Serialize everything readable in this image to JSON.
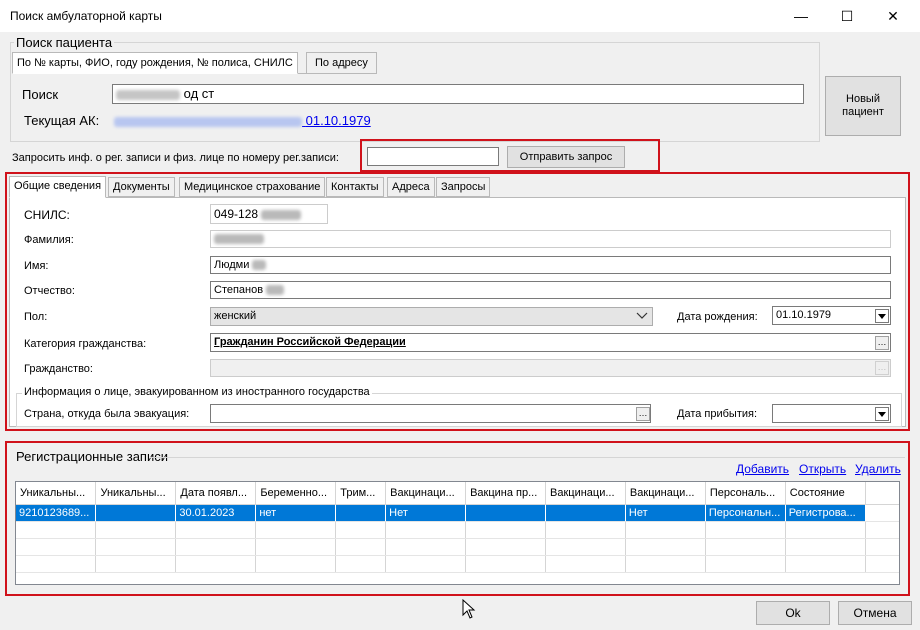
{
  "window": {
    "title": "Поиск амбулаторной карты",
    "minimize": "—",
    "maximize": "☐",
    "close": "✕"
  },
  "patient_search": {
    "group_title": "Поиск пациента",
    "tabs": [
      {
        "label": "По № карты, ФИО, году рождения, № полиса, СНИЛС"
      },
      {
        "label": "По адресу"
      }
    ],
    "search_label": "Поиск",
    "search_value": "од ст",
    "current_card_label": "Текущая АК:",
    "current_card_date": "01.10.1979",
    "new_patient_button": "Новый пациент"
  },
  "request": {
    "label": "Запросить инф. о рег. записи и физ. лице по номеру рег.записи:",
    "input_value": "",
    "send_button": "Отправить запрос"
  },
  "tabs": [
    {
      "label": "Общие сведения"
    },
    {
      "label": "Документы"
    },
    {
      "label": "Медицинское страхование"
    },
    {
      "label": "Контакты"
    },
    {
      "label": "Адреса"
    },
    {
      "label": "Запросы"
    }
  ],
  "general": {
    "snils_label": "СНИЛС:",
    "snils_value": "049-128",
    "surname_label": "Фамилия:",
    "name_label": "Имя:",
    "name_value": "Людми",
    "patronymic_label": "Отчество:",
    "patronymic_value": "Степанов",
    "sex_label": "Пол:",
    "sex_value": "женский",
    "birthdate_label": "Дата рождения:",
    "birthdate_value": "01.10.1979",
    "citizenship_category_label": "Категория гражданства:",
    "citizenship_category_value": "Гражданин Российской Федерации",
    "citizenship_label": "Гражданство:",
    "evacuated_group": "Информация о лице, эвакуированном из иностранного государства",
    "evacuation_country_label": "Страна, откуда была эвакуация:",
    "arrival_date_label": "Дата прибытия:"
  },
  "registrations": {
    "group_title": "Регистрационные записи",
    "add_link": "Добавить",
    "open_link": "Открыть",
    "delete_link": "Удалить",
    "columns": [
      "Уникальны...",
      "Уникальны...",
      "Дата появл...",
      "Беременно...",
      "Трим...",
      "Вакцинаци...",
      "Вакцина пр...",
      "Вакцинаци...",
      "Вакцинаци...",
      "Персональ...",
      "Состояние"
    ],
    "rows": [
      [
        "9210123689...",
        "",
        "30.01.2023",
        "нет",
        "",
        "Нет",
        "",
        "",
        "Нет",
        "Персональн...",
        "Регистрова..."
      ]
    ]
  },
  "footer": {
    "ok_button": "Ok",
    "cancel_button": "Отмена"
  },
  "colors": {
    "selection": "#0078d7",
    "highlight_border": "#d0121b",
    "link": "#0000ee"
  }
}
